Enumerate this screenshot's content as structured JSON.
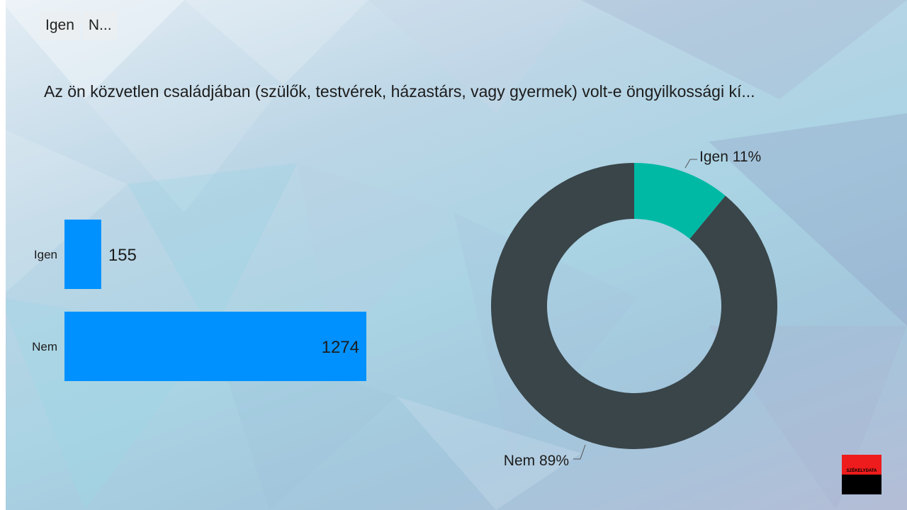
{
  "tabs": [
    {
      "label": "Igen"
    },
    {
      "label": "N..."
    }
  ],
  "question": "Az ön közvetlen családjában (szülők, testvérek, házastárs, vagy gyermek) volt-e öngyilkossági kí...",
  "logo_text": "SZÉKELYDATA",
  "colors": {
    "bar": "#0091ff",
    "donut_igen": "#00b9a5",
    "donut_nem": "#394549",
    "text": "#1c1c1c"
  },
  "chart_data": [
    {
      "type": "bar",
      "orientation": "horizontal",
      "categories": [
        "Igen",
        "Nem"
      ],
      "values": [
        155,
        1274
      ],
      "data_labels": [
        "155",
        "1274"
      ],
      "grid": false
    },
    {
      "type": "pie",
      "variant": "donut",
      "labels": [
        "Igen",
        "Nem"
      ],
      "values": [
        11,
        89
      ],
      "data_labels": [
        "Igen 11%",
        "Nem 89%"
      ]
    }
  ]
}
